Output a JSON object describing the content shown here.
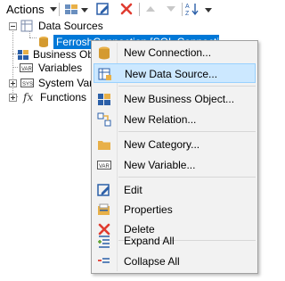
{
  "toolbar": {
    "actions_label": "Actions",
    "icons": [
      "new-item-icon",
      "edit-icon",
      "delete-icon",
      "move-up-icon",
      "move-down-icon",
      "sort-icon"
    ]
  },
  "tree": {
    "data_sources": "Data Sources",
    "connection": "FerroshConnection [SQL Connection]",
    "business_objects": "Business Obj",
    "variables": "Variables",
    "system_variables": "System Vari",
    "functions": "Functions"
  },
  "menu": {
    "items": [
      {
        "label": "New Connection...",
        "icon": "new-connection-icon"
      },
      {
        "label": "New Data Source...",
        "icon": "new-data-source-icon"
      },
      {
        "label": "New Business Object...",
        "icon": "new-business-object-icon"
      },
      {
        "label": "New Relation...",
        "icon": "new-relation-icon"
      },
      {
        "label": "New Category...",
        "icon": "new-category-icon"
      },
      {
        "label": "New Variable...",
        "icon": "new-variable-icon"
      },
      {
        "label": "Edit",
        "icon": "edit-icon"
      },
      {
        "label": "Properties",
        "icon": "properties-icon"
      },
      {
        "label": "Delete",
        "icon": "delete-icon"
      },
      {
        "label": "Expand All",
        "icon": "expand-all-icon"
      },
      {
        "label": "Collapse All",
        "icon": "collapse-all-icon"
      }
    ]
  },
  "colors": {
    "selection": "#0078d7",
    "menu_hover": "#cce8ff",
    "delete_red": "#e03c31"
  }
}
